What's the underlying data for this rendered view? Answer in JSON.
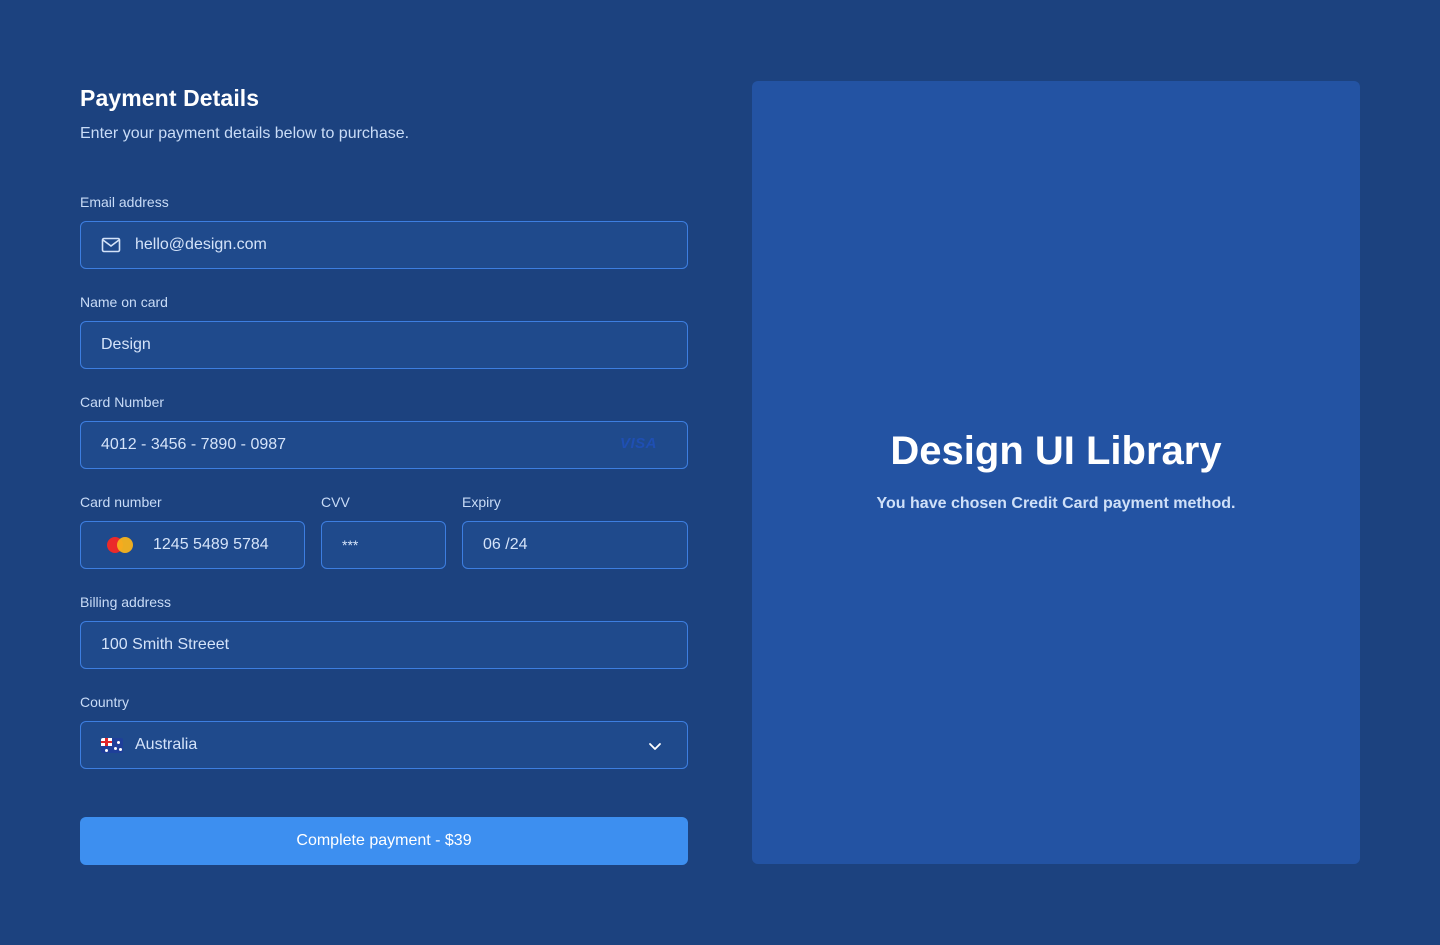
{
  "header": {
    "title": "Payment Details",
    "subtitle": "Enter your payment details below to purchase."
  },
  "form": {
    "email": {
      "label": "Email address",
      "value": "hello@design.com",
      "icon": "mail-icon"
    },
    "name_on_card": {
      "label": "Name on card",
      "value": "Design"
    },
    "card_number": {
      "label": "Card Number",
      "value": "4012 - 3456 - 7890 - 0987",
      "brand": "VISA"
    },
    "card_number_short": {
      "label": "Card number",
      "value": "1245 5489 5784",
      "icon": "mastercard-icon"
    },
    "cvv": {
      "label": "CVV",
      "value": "***"
    },
    "expiry": {
      "label": "Expiry",
      "value": "06 /24"
    },
    "billing_address": {
      "label": "Billing address",
      "value": "100 Smith Streeet"
    },
    "country": {
      "label": "Country",
      "value": "Australia",
      "icon": "australia-flag-icon"
    },
    "submit_label": "Complete payment - $39"
  },
  "panel": {
    "title": "Design UI Library",
    "subtitle": "You have chosen Credit Card payment method."
  },
  "colors": {
    "background": "#1c427f",
    "field_border": "#3d7ee0",
    "button": "#3d8ff0",
    "panel": "#2353a3"
  }
}
